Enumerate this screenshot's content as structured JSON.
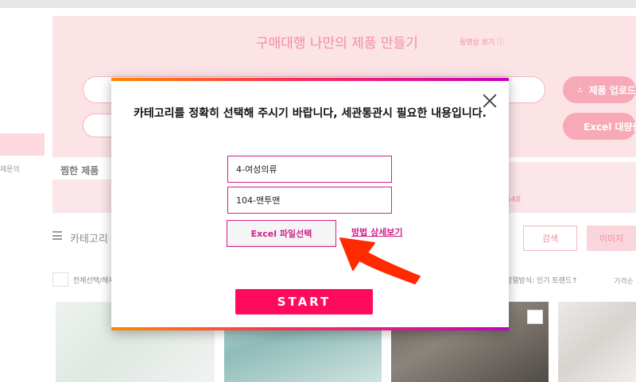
{
  "background": {
    "panel_title": "구매대행 나만의 제품 만들기",
    "panel_sub": "동영상 보기 ⓘ",
    "upload_button": "제품 업로드",
    "excel_button": "Excel 대량등록",
    "side_text": "제문의",
    "tab_label": "찜한 제품",
    "tab_count": "548",
    "category_label": "카테고리",
    "search_button": "검색",
    "image_button": "이미지",
    "select_all": "전체선택/해제",
    "sort_label": "정렬방식: 인기 트렌드↑",
    "price_label": "가격순"
  },
  "modal": {
    "message": "카테고리를 정확히 선택해 주시기 바랍니다, 세관통관시 필요한 내용입니다.",
    "category_level1_value": "4-여성의류",
    "category_level2_value": "104-맨투맨",
    "file_button_label": "Excel 파일선택",
    "help_link_label": "방법 상세보기",
    "start_button_label": "START"
  },
  "colors": {
    "accent": "#d0208a",
    "start": "#ff0a5c",
    "arrow": "#ff2a00"
  },
  "icons": [
    "close-icon",
    "upload-icon",
    "menu-icon",
    "pointer-arrow-icon"
  ]
}
